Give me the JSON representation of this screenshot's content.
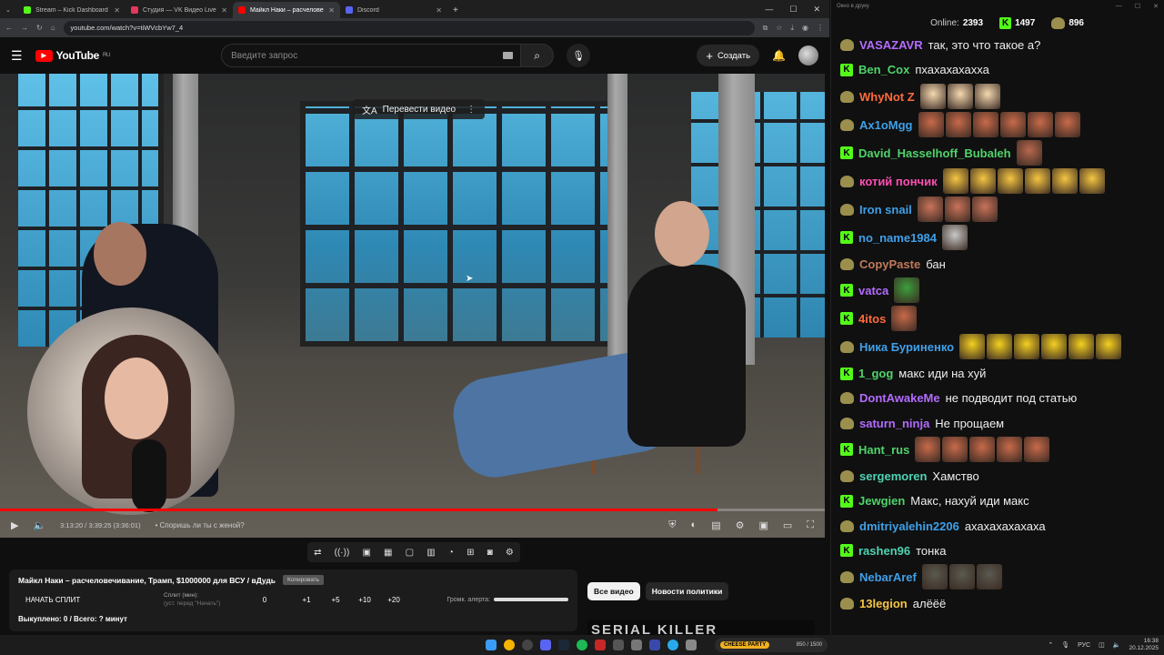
{
  "browser": {
    "tabs": [
      {
        "label": "Stream – Kick Dashboard",
        "color": "#53fc18",
        "active": false
      },
      {
        "label": "Студия — VK Видео Live",
        "color": "#e8365d",
        "active": false
      },
      {
        "label": "Майкл Наки – расчеловечивание",
        "color": "#ff0000",
        "active": true
      },
      {
        "label": "Discord",
        "color": "#5865f2",
        "active": false
      }
    ],
    "new_tab": "+",
    "url": "youtube.com/watch?v=tiWVcbYw7_4"
  },
  "youtube": {
    "logo_text": "YouTube",
    "logo_region": "RU",
    "search_placeholder": "Введите запрос",
    "create_label": "Создать",
    "translate_label": "Перевести видео",
    "timecode": "3:13:20 / 3:39:25 (3:36:01)",
    "chapter": "• Споришь ли ты с женой?",
    "progress_fraction": 0.87,
    "chips": [
      "Все видео",
      "Новости политики"
    ],
    "thumb_text": "SERIAL KILLER"
  },
  "split_panel": {
    "title": "Майкл Наки – расчеловечивание, Трамп, $1000000 для ВСУ / вДудь",
    "copy_label": "Копировать",
    "start_label": "НАЧАТЬ СПЛИТ",
    "split_min_label": "Сплит (мин):",
    "split_min_hint": "(уст. перед \"Начать\")",
    "split_value": "0",
    "increments": [
      "+1",
      "+5",
      "+10",
      "+20"
    ],
    "alert_volume_label": "Громк. алерта:",
    "footer": "Выкуплено: 0 / Всего: ? минут"
  },
  "chat": {
    "window_title": "Окно в друку",
    "online_label": "Online:",
    "online_count": "2393",
    "kick_count": "1497",
    "other_count": "896",
    "messages": [
      {
        "user": "VASAZAVR",
        "color": "#b36cff",
        "badge": "crown",
        "text": "так, это что такое а?",
        "emotes": 0,
        "emote_color": ""
      },
      {
        "user": "Ben_Cox",
        "color": "#4fd36b",
        "badge": "kick",
        "text": "пхахахахахха",
        "emotes": 0,
        "emote_color": ""
      },
      {
        "user": "WhyNot Z",
        "color": "#ff6a3d",
        "badge": "crown",
        "text": "",
        "emotes": 3,
        "emote_color": "#f5d9b0"
      },
      {
        "user": "Ax1oMgg",
        "color": "#3fa0e8",
        "badge": "crown",
        "text": "",
        "emotes": 6,
        "emote_color": "#c86a4a"
      },
      {
        "user": "David_Hasselhoff_Bubaleh",
        "color": "#4fd36b",
        "badge": "kick",
        "text": "",
        "emotes": 1,
        "emote_color": "#b8684e"
      },
      {
        "user": "котий пончик",
        "color": "#ff4fb3",
        "badge": "crown",
        "text": "",
        "emotes": 6,
        "emote_color": "#f5c542"
      },
      {
        "user": "Iron snail",
        "color": "#3fa0e8",
        "badge": "crown",
        "text": "",
        "emotes": 3,
        "emote_color": "#c9735a"
      },
      {
        "user": "no_name1984",
        "color": "#3fa0e8",
        "badge": "kick",
        "text": "",
        "emotes": 1,
        "emote_color": "#c8c8c8"
      },
      {
        "user": "CopyPaste",
        "color": "#c07a5a",
        "badge": "crown",
        "text": "бан",
        "emotes": 0,
        "emote_color": ""
      },
      {
        "user": "vatca",
        "color": "#b36cff",
        "badge": "kick",
        "text": "",
        "emotes": 1,
        "emote_color": "#3c9e3c"
      },
      {
        "user": "4itos",
        "color": "#ff6a3d",
        "badge": "kick",
        "text": "",
        "emotes": 1,
        "emote_color": "#c86a4a"
      },
      {
        "user": "Ника Буриненко",
        "color": "#3fa0e8",
        "badge": "crown",
        "text": "",
        "emotes": 6,
        "emote_color": "#f5d020"
      },
      {
        "user": "1_gog",
        "color": "#4fd36b",
        "badge": "kick",
        "text": "макс иди на хуй",
        "emotes": 0,
        "emote_color": ""
      },
      {
        "user": "DontAwakeMe",
        "color": "#b36cff",
        "badge": "crown",
        "text": "не подводит под статью",
        "emotes": 0,
        "emote_color": ""
      },
      {
        "user": "saturn_ninja",
        "color": "#b36cff",
        "badge": "crown",
        "text": "Не прощаем",
        "emotes": 0,
        "emote_color": ""
      },
      {
        "user": "Hant_rus",
        "color": "#4fd36b",
        "badge": "kick",
        "text": "",
        "emotes": 5,
        "emote_color": "#c86a4a"
      },
      {
        "user": "sergemoren",
        "color": "#4fd3b3",
        "badge": "crown",
        "text": "Хамство",
        "emotes": 0,
        "emote_color": ""
      },
      {
        "user": "Jewgien",
        "color": "#4fd36b",
        "badge": "kick",
        "text": "Макс, нахуй иди макс",
        "emotes": 0,
        "emote_color": ""
      },
      {
        "user": "dmitriyalehin2206",
        "color": "#3fa0e8",
        "badge": "crown",
        "text": "ахахахахахаха",
        "emotes": 0,
        "emote_color": ""
      },
      {
        "user": "rashen96",
        "color": "#4fd3b3",
        "badge": "kick",
        "text": "тонка",
        "emotes": 0,
        "emote_color": ""
      },
      {
        "user": "NebarAref",
        "color": "#3fa0e8",
        "badge": "crown",
        "text": "",
        "emotes": 3,
        "emote_color": "#5a5a50"
      },
      {
        "user": "13legion",
        "color": "#f5c542",
        "badge": "crown",
        "text": "алёёё",
        "emotes": 0,
        "emote_color": ""
      }
    ]
  },
  "taskbar": {
    "game_widget_left": "CHEESE PARTY",
    "game_widget_right": "850 / 1500",
    "lang": "РУС",
    "time": "16:38",
    "date": "20.12.2025"
  }
}
